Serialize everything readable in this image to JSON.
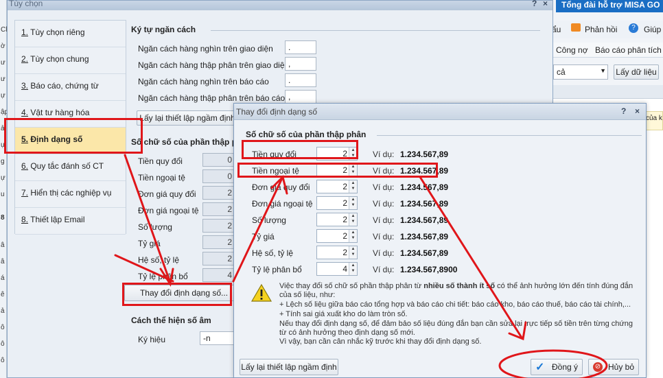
{
  "background_app": {
    "title_fragment": "Tổng đài hỗ trợ MISA GO",
    "toolbar": [
      "ẩu",
      "Phản hồi",
      "Giúp"
    ],
    "tabs": [
      "Công nợ",
      "Báo cáo phân tích"
    ],
    "filter_value": "cả",
    "load_button": "Lấy dữ liệu",
    "note_text": "của k",
    "left_strip": [
      "Cl",
      "ờ",
      "ư",
      "ư",
      "ự",
      "ập",
      "ảl",
      "ự",
      "g",
      "ự",
      "u",
      "8",
      "â",
      "â",
      "á",
      "ê",
      "ả",
      "ô",
      "ô",
      "ô"
    ]
  },
  "window": {
    "title": "Tùy chọn",
    "help": "?",
    "close": "×"
  },
  "nav": {
    "items": [
      {
        "num": "1.",
        "label": " Tùy chọn riêng"
      },
      {
        "num": "2.",
        "label": " Tùy chọn chung"
      },
      {
        "num": "3.",
        "label": " Báo cáo, chứng từ"
      },
      {
        "num": "4.",
        "label": " Vật tư hàng hóa"
      },
      {
        "num": "5.",
        "label": " Định dạng số"
      },
      {
        "num": "6.",
        "label": " Quy tắc đánh số CT"
      },
      {
        "num": "7.",
        "label": " Hiển thị các nghiệp vụ"
      },
      {
        "num": "8.",
        "label": " Thiết lập Email"
      }
    ]
  },
  "separator_group": {
    "title": "Ký tự ngăn cách",
    "rows": [
      {
        "label": "Ngăn cách hàng nghìn trên giao diện",
        "value": "."
      },
      {
        "label": "Ngăn cách hàng thập phân trên giao diện",
        "value": ","
      },
      {
        "label": "Ngăn cách hàng nghìn trên báo cáo",
        "value": "."
      },
      {
        "label": "Ngăn cách hàng thập phân trên báo cáo",
        "value": ","
      }
    ],
    "reset_button": "Lấy lại thiết lập ngầm định"
  },
  "decimal_group": {
    "title": "Số chữ số của phần thập phân",
    "rows": [
      {
        "label": "Tiền quy đổi",
        "value": "0"
      },
      {
        "label": "Tiền ngoại tệ",
        "value": "0"
      },
      {
        "label": "Đơn giá quy đổi",
        "value": "2"
      },
      {
        "label": "Đơn giá ngoại tệ",
        "value": "2"
      },
      {
        "label": "Số lượng",
        "value": "2"
      },
      {
        "label": "Tỷ giá",
        "value": "2"
      },
      {
        "label": "Hệ số, tỷ lệ",
        "value": "2"
      },
      {
        "label": "Tỷ lệ phân bổ",
        "value": "4"
      }
    ],
    "change_button": "Thay đổi định dạng số..."
  },
  "negative_group": {
    "title": "Cách thể hiện số âm",
    "label": "Ký hiệu",
    "value": "-n"
  },
  "dialog": {
    "title": "Thay đổi định dạng số",
    "help": "?",
    "close": "×",
    "group_title": "Số chữ số của phần thập phân",
    "example_label": "Ví dụ:",
    "rows": [
      {
        "label": "Tiền quy đổi",
        "value": "2",
        "example": "1.234.567,89"
      },
      {
        "label": "Tiền ngoại tệ",
        "value": "2",
        "example": "1.234.567,89"
      },
      {
        "label": "Đơn giá quy đổi",
        "value": "2",
        "example": "1.234.567,89"
      },
      {
        "label": "Đơn giá ngoại tệ",
        "value": "2",
        "example": "1.234.567,89"
      },
      {
        "label": "Số lượng",
        "value": "2",
        "example": "1.234.567,89"
      },
      {
        "label": "Tỷ giá",
        "value": "2",
        "example": "1.234.567,89"
      },
      {
        "label": "Hệ số, tỷ lệ",
        "value": "2",
        "example": "1.234.567,89"
      },
      {
        "label": "Tỷ lệ phân bổ",
        "value": "4",
        "example": "1.234.567,8900"
      }
    ],
    "warning": {
      "line1_a": "Việc thay đổi số chữ số phần thập phân từ ",
      "line1_b": "nhiều số thành ít số",
      "line1_c": " có thể ảnh hưởng lớn đến tính đúng đắn",
      "line2": "của số liệu, như:",
      "line3": "+ Lệch số liệu giữa báo cáo tổng hợp và báo cáo chi tiết: báo cáo kho, báo cáo thuế, báo cáo tài chính,...",
      "line4": "+ Tính sai giá xuất kho do làm tròn số.",
      "line5": "Nếu thay đổi định dạng số, để đảm bảo số liệu đúng đắn bạn cần sửa lại trực tiếp số tiền trên từng chứng",
      "line6": "từ có ảnh hưởng theo định dạng số mới.",
      "line7": "Vì vậy, bạn cần cân nhắc kỹ trước khi thay đổi định dạng số."
    },
    "reset_button": "Lấy lại thiết lập ngầm định",
    "ok_button": "Đồng ý",
    "cancel_button": "Hủy bỏ"
  }
}
